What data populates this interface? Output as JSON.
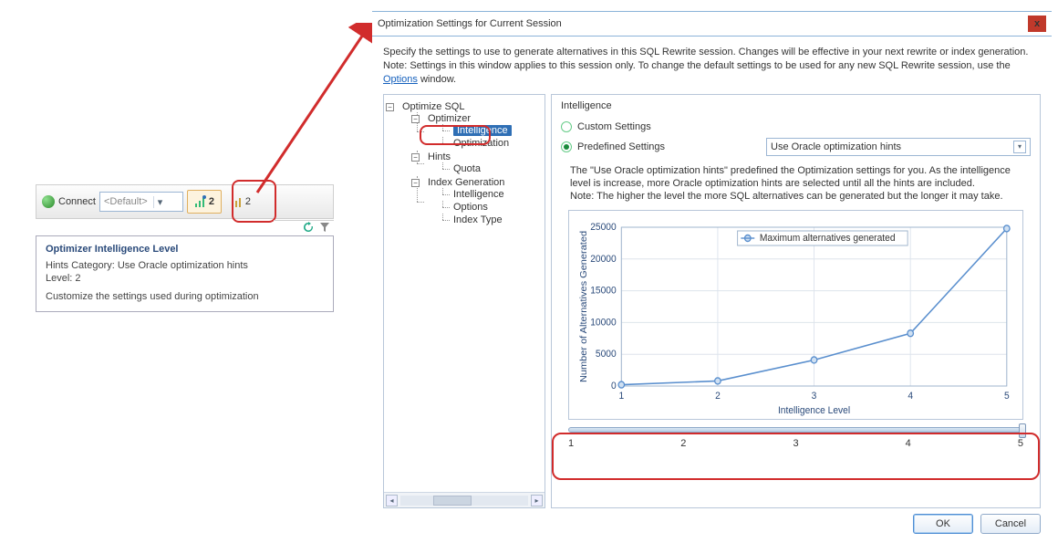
{
  "toolbar": {
    "connect_label": "Connect",
    "combo_value": "<Default>",
    "level_button_value": "2",
    "level_button2_value": "2"
  },
  "tooltip": {
    "title": "Optimizer Intelligence Level",
    "line1": "Hints Category: Use Oracle optimization hints",
    "line2": "Level: 2",
    "line3": "Customize the settings used during optimization"
  },
  "dialog": {
    "title": "Optimization Settings for Current Session",
    "close": "x",
    "intro1": "Specify the settings to use to generate alternatives in this SQL Rewrite session. Changes will be effective in your next rewrite or index generation.",
    "intro2a": "Note: Settings in this window applies to this session only. To change the default settings to be used for any new SQL Rewrite session, use the ",
    "intro_link": "Options",
    "intro2b": " window.",
    "ok": "OK",
    "cancel": "Cancel"
  },
  "tree": {
    "root": "Optimize SQL",
    "optimizer": "Optimizer",
    "intelligence": "Intelligence",
    "optimization": "Optimization",
    "hints": "Hints",
    "quota": "Quota",
    "indexgen": "Index Generation",
    "ig_intelligence": "Intelligence",
    "ig_options": "Options",
    "ig_indextype": "Index Type"
  },
  "panel": {
    "heading": "Intelligence",
    "radio_custom": "Custom Settings",
    "radio_predef": "Predefined Settings",
    "select_value": "Use Oracle optimization hints",
    "desc1": "The \"Use Oracle optimization hints\" predefined the Optimization settings for you. As the intelligence level is increase, more Oracle optimization hints are selected until all the hints are included.",
    "desc2": "Note: The higher the level the more SQL alternatives can be generated but the longer it may take."
  },
  "slider": {
    "t1": "1",
    "t2": "2",
    "t3": "3",
    "t4": "4",
    "t5": "5",
    "value": 5
  },
  "chart_data": {
    "type": "line",
    "title": "",
    "xlabel": "Intelligence Level",
    "ylabel": "Number of Alternatives Generated",
    "legend": "Maximum alternatives generated",
    "x": [
      1,
      2,
      3,
      4,
      5
    ],
    "values": [
      200,
      800,
      4100,
      8300,
      24800
    ],
    "xlim": [
      1,
      5
    ],
    "ylim": [
      0,
      25000
    ],
    "yticks": [
      0,
      5000,
      10000,
      15000,
      20000,
      25000
    ]
  },
  "colors": {
    "accent": "#4f8ed4",
    "annot": "#d12c2c",
    "line": "#5a8fce"
  }
}
